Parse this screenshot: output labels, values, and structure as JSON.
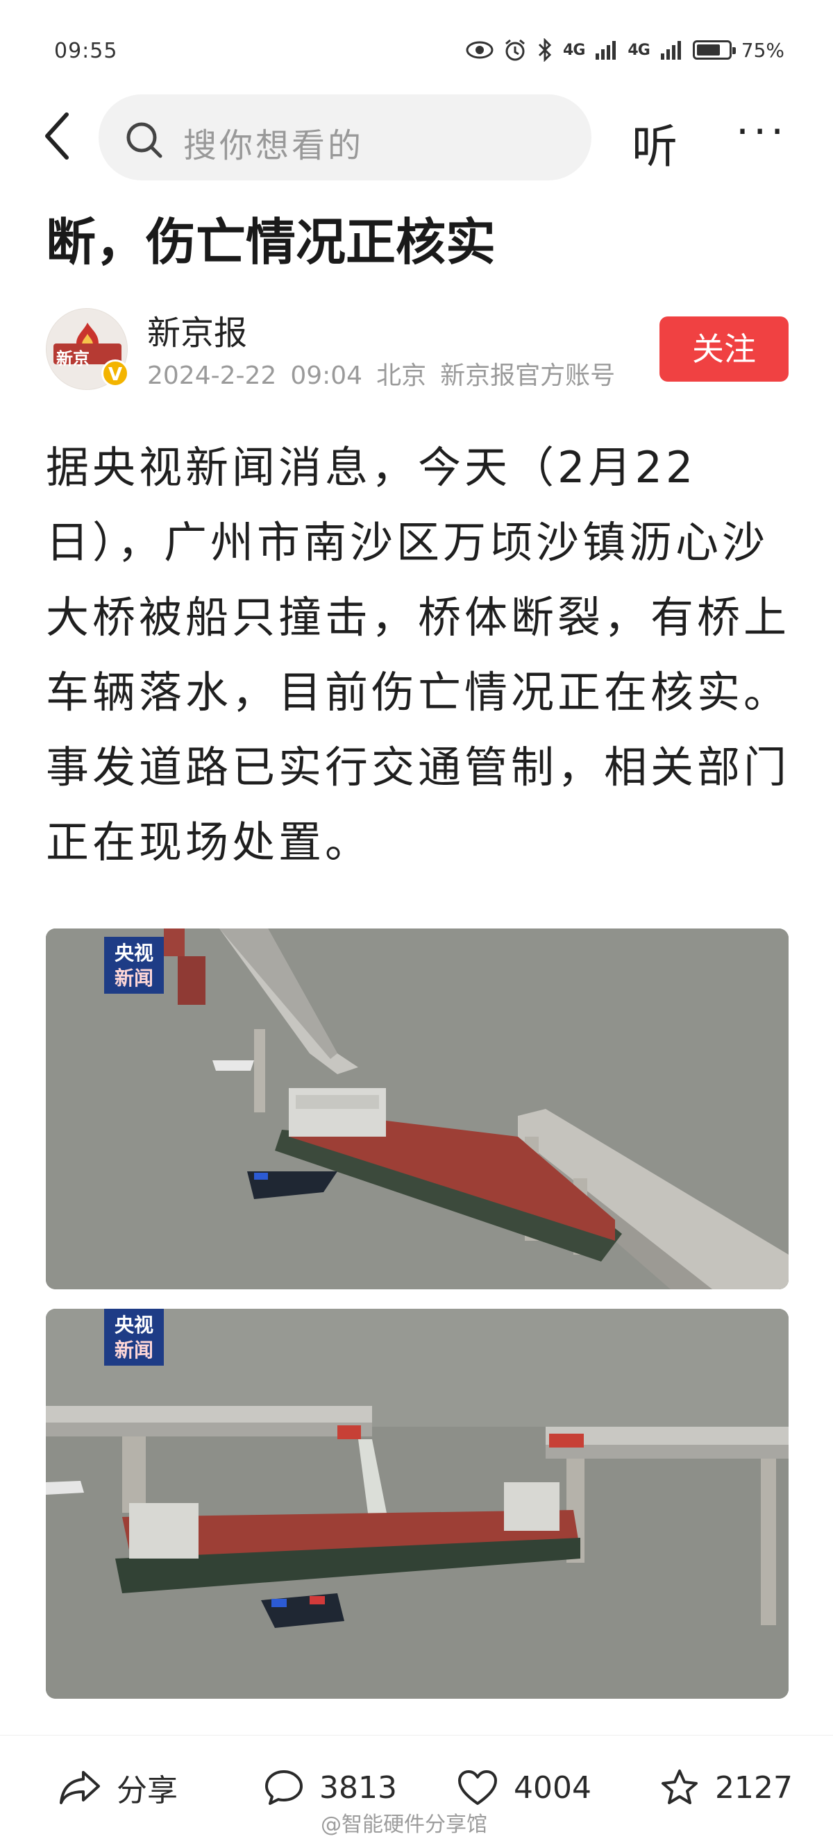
{
  "status_bar": {
    "time": "09:55",
    "network_1": "4G",
    "network_2": "4G",
    "battery_percent": 75,
    "battery_text": "75%",
    "icons": [
      "eye-icon",
      "alarm-icon",
      "bluetooth-icon",
      "signal-icon",
      "battery-icon"
    ]
  },
  "nav": {
    "search_placeholder": "搜你想看的",
    "listen_label": "听",
    "more_label": "···"
  },
  "article": {
    "headline": "断，伤亡情况正核实",
    "author": {
      "name": "新京报",
      "avatar_text": "新京",
      "date": "2024-2-22",
      "time": "09:04",
      "location": "北京",
      "account_type": "新京报官方账号",
      "verified_mark": "V",
      "follow_label": "关注"
    },
    "body": "据央视新闻消息，今天（2月22日），广州市南沙区万顷沙镇沥心沙大桥被船只撞击，桥体断裂，有桥上车辆落水，目前伤亡情况正在核实。事发道路已实行交通管制，相关部门正在现场处置。",
    "images": [
      {
        "logo_line1": "央视",
        "logo_line2": "新闻"
      },
      {
        "logo_line1": "央视",
        "logo_line2": "新闻"
      }
    ]
  },
  "bottom_bar": {
    "share_label": "分享",
    "comments": "3813",
    "likes": "4004",
    "favorites": "2127",
    "watermark": "@智能硬件分享馆"
  },
  "colors": {
    "accent_red": "#f04142",
    "verified_gold": "#f3b400",
    "cctv_blue": "#1e3c86"
  }
}
